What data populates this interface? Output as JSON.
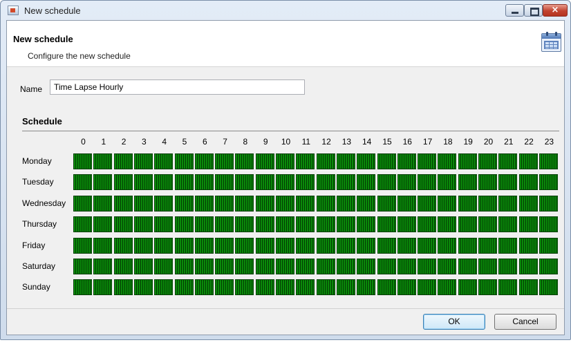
{
  "window": {
    "title": "New schedule",
    "icon": "schedule-app-icon",
    "controls": {
      "minimize_icon": "minimize-icon",
      "maximize_icon": "maximize-icon",
      "close_icon": "close-icon",
      "close_glyph": "×"
    }
  },
  "header": {
    "title": "New schedule",
    "subtitle": "Configure the new schedule",
    "icon": "calendar-icon"
  },
  "form": {
    "name_label": "Name",
    "name_value": "Time Lapse Hourly"
  },
  "schedule": {
    "label": "Schedule",
    "hours": [
      "0",
      "1",
      "2",
      "3",
      "4",
      "5",
      "6",
      "7",
      "8",
      "9",
      "10",
      "11",
      "12",
      "13",
      "14",
      "15",
      "16",
      "17",
      "18",
      "19",
      "20",
      "21",
      "22",
      "23"
    ],
    "days": [
      "Monday",
      "Tuesday",
      "Wednesday",
      "Thursday",
      "Friday",
      "Saturday",
      "Sunday"
    ],
    "all_hours_selected": true,
    "selected_color": "#0a8a0a",
    "divider_color": "#023b02"
  },
  "buttons": {
    "ok": "OK",
    "cancel": "Cancel"
  }
}
